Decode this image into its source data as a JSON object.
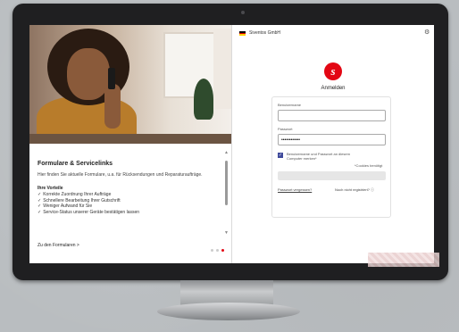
{
  "brand": {
    "company": "Siventos GmbH",
    "logo_letter": "s",
    "accent": "#e30613"
  },
  "left": {
    "title": "Formulare & Servicelinks",
    "intro": "Hier finden Sie aktuelle Formulare, u.a. für Rücksendungen und Reparaturaufträge.",
    "benefits_title": "Ihre Vorteile",
    "benefits": [
      "Korrekte Zuordnung Ihrer Aufträge",
      "Schnellere Bearbeitung Ihrer Gutschrift",
      "Weniger Aufwand für Sie",
      "Service-Status unserer Geräte bestätigen lassen"
    ],
    "link": "Zu den Formularen >",
    "carousel": {
      "total": 3,
      "active": 3
    }
  },
  "login": {
    "heading": "Anmelden",
    "username_label": "Benutzername",
    "username_value": "",
    "password_label": "Passwort",
    "password_value": "••••••••••••",
    "remember_label": "Benutzername und Passwort an diesem Computer merken*",
    "remember_checked": true,
    "cookies_note": "*Cookies benötigt",
    "forgot": "Passwort vergessen?",
    "not_registered": "Noch nicht registriert?",
    "info_icon": "info-icon",
    "settings_icon": "gear-icon"
  }
}
